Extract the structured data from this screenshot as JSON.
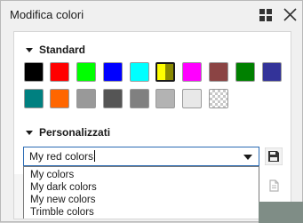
{
  "window": {
    "title": "Modifica colori"
  },
  "icons": {
    "dock": "dock-grid-icon",
    "close": "close-icon",
    "save": "floppy-disk-icon",
    "disabled": "document-icon"
  },
  "standard": {
    "label": "Standard",
    "colors": [
      "#000000",
      "#ff0000",
      "#00ff00",
      "#0000ff",
      "#00ffff",
      "#ffff00 / #8a8a00",
      "#ff00ff",
      "#8b4444",
      "#008000",
      "#333399",
      "#008080",
      "#ff6600",
      "#999999",
      "#555555",
      "#808080",
      "#b3b3b3",
      "#e8e8e8",
      "transparent"
    ]
  },
  "custom": {
    "label": "Personalizzati",
    "selected": "My red colors",
    "options": [
      "My colors",
      "My dark colors",
      "My new colors",
      "Trimble colors"
    ]
  }
}
